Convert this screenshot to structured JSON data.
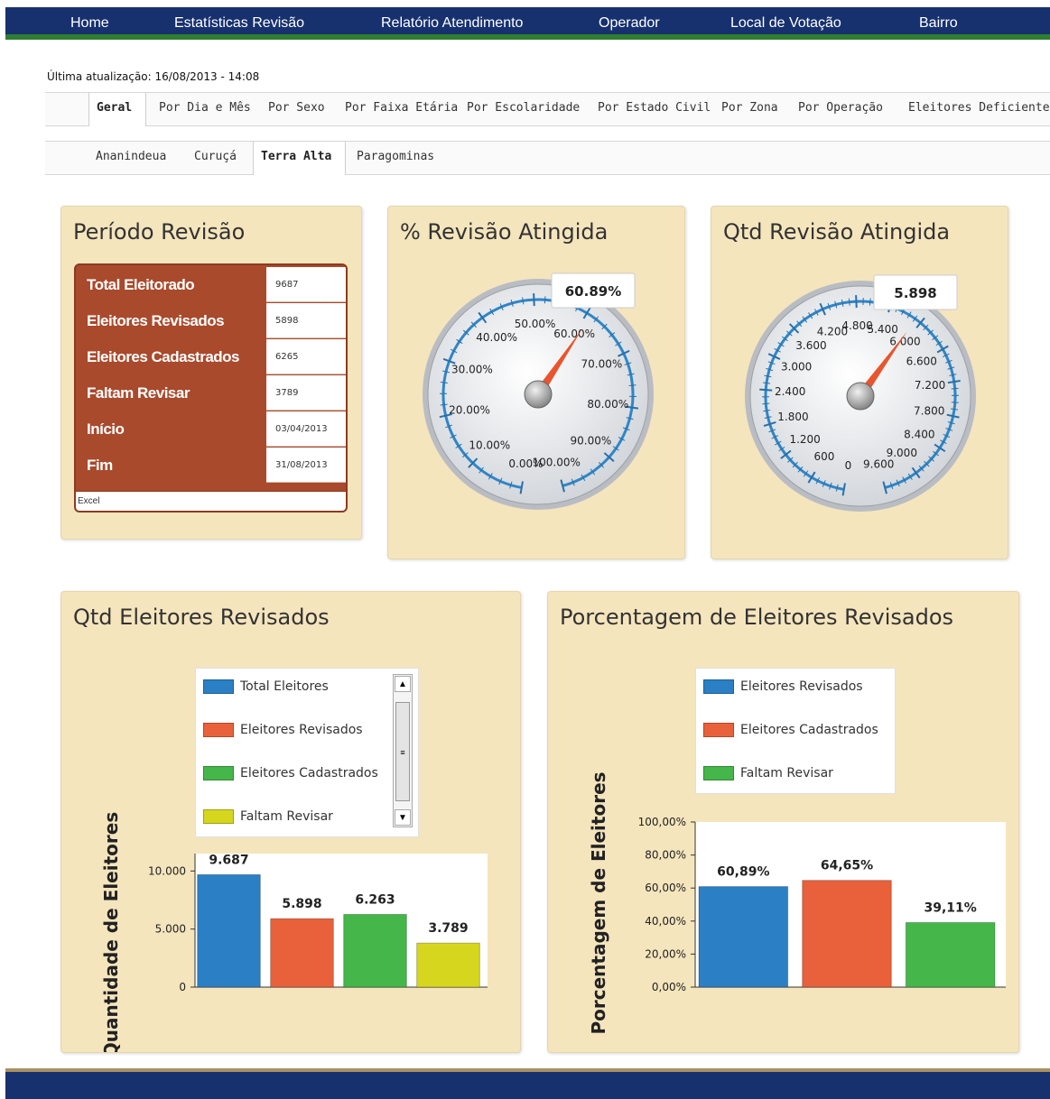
{
  "nav": {
    "items": [
      "Home",
      "Estatísticas Revisão",
      "Relatório Atendimento",
      "Operador",
      "Local de Votação",
      "Bairro"
    ]
  },
  "last_update": "Última atualização: 16/08/2013 - 14:08",
  "tabs_main": {
    "items": [
      "Geral",
      "Por Dia e Mês",
      "Por Sexo",
      "Por Faixa Etária",
      "Por Escolaridade",
      "Por Estado Civil",
      "Por Zona",
      "Por Operação",
      "Eleitores Deficientes"
    ],
    "active": "Geral"
  },
  "tabs_city": {
    "items": [
      "Ananindeua",
      "Curuçá",
      "Terra Alta",
      "Paragominas"
    ],
    "active": "Terra Alta"
  },
  "periodo": {
    "title": "Período Revisão",
    "rows": [
      {
        "label": "Total Eleitorado",
        "value": "9687"
      },
      {
        "label": "Eleitores Revisados",
        "value": "5898"
      },
      {
        "label": "Eleitores Cadastrados",
        "value": "6265"
      },
      {
        "label": "Faltam Revisar",
        "value": "3789"
      },
      {
        "label": "Início",
        "value": "03/04/2013"
      },
      {
        "label": "Fim",
        "value": "31/08/2013"
      }
    ],
    "excel_label": "Excel"
  },
  "gauge_pct": {
    "title": "% Revisão Atingida",
    "value_label": "60.89%",
    "value": 60.89,
    "min": 0,
    "max": 100,
    "tick_labels": [
      "0.00%",
      "10.00%",
      "20.00%",
      "30.00%",
      "40.00%",
      "50.00%",
      "60.00%",
      "70.00%",
      "80.00%",
      "90.00%",
      "100.00%"
    ]
  },
  "gauge_qty": {
    "title": "Qtd Revisão Atingida",
    "value_label": "5.898",
    "value": 5898,
    "min": 0,
    "max": 9600,
    "tick_labels": [
      "0",
      "600",
      "1.200",
      "1.800",
      "2.400",
      "3.000",
      "3.600",
      "4.200",
      "4.800",
      "5.400",
      "6.000",
      "6.600",
      "7.200",
      "7.800",
      "8.400",
      "9.000",
      "9.600"
    ]
  },
  "qtd_chart": {
    "title": "Qtd Eleitores Revisados",
    "legend": [
      "Total Eleitores",
      "Eleitores Revisados",
      "Eleitores Cadastrados",
      "Faltam Revisar"
    ],
    "scroll_up": "▲",
    "scroll_down": "▼",
    "scroll_grip": "≡"
  },
  "pct_chart": {
    "title": "Porcentagem de Eleitores Revisados",
    "legend": [
      "Eleitores Revisados",
      "Eleitores Cadastrados",
      "Faltam Revisar"
    ]
  },
  "colors": {
    "blue": "#2b7fc4",
    "orange": "#e8613b",
    "green": "#45b649",
    "yellow": "#d6d61e",
    "nav_bg": "#17316f",
    "panel_bg": "#f5e5bd",
    "table_bg": "#a94a2c"
  },
  "chart_data": [
    {
      "type": "bar",
      "categories": [
        "Total Eleitores",
        "Eleitores Revisados",
        "Eleitores Cadastrados",
        "Faltam Revisar"
      ],
      "values": [
        9687,
        5898,
        6263,
        3789
      ],
      "value_labels": [
        "9.687",
        "5.898",
        "6.263",
        "3.789"
      ],
      "colors": [
        "#2b7fc4",
        "#e8613b",
        "#45b649",
        "#d6d61e"
      ],
      "ylabel": "Quantidade de Eleitores",
      "ylim": [
        0,
        11500
      ],
      "yticks": [
        0,
        5000,
        10000
      ],
      "ytick_labels": [
        "0",
        "5.000",
        "10.000"
      ]
    },
    {
      "type": "bar",
      "categories": [
        "Eleitores Revisados",
        "Eleitores Cadastrados",
        "Faltam Revisar"
      ],
      "values": [
        60.89,
        64.65,
        39.11
      ],
      "value_labels": [
        "60,89%",
        "64,65%",
        "39,11%"
      ],
      "colors": [
        "#2b7fc4",
        "#e8613b",
        "#45b649"
      ],
      "ylabel": "Porcentagem de Eleitores",
      "ylim": [
        0,
        100
      ],
      "yticks": [
        0,
        20,
        40,
        60,
        80,
        100
      ],
      "ytick_labels": [
        "0,00%",
        "20,00%",
        "40,00%",
        "60,00%",
        "80,00%",
        "100,00%"
      ]
    }
  ]
}
